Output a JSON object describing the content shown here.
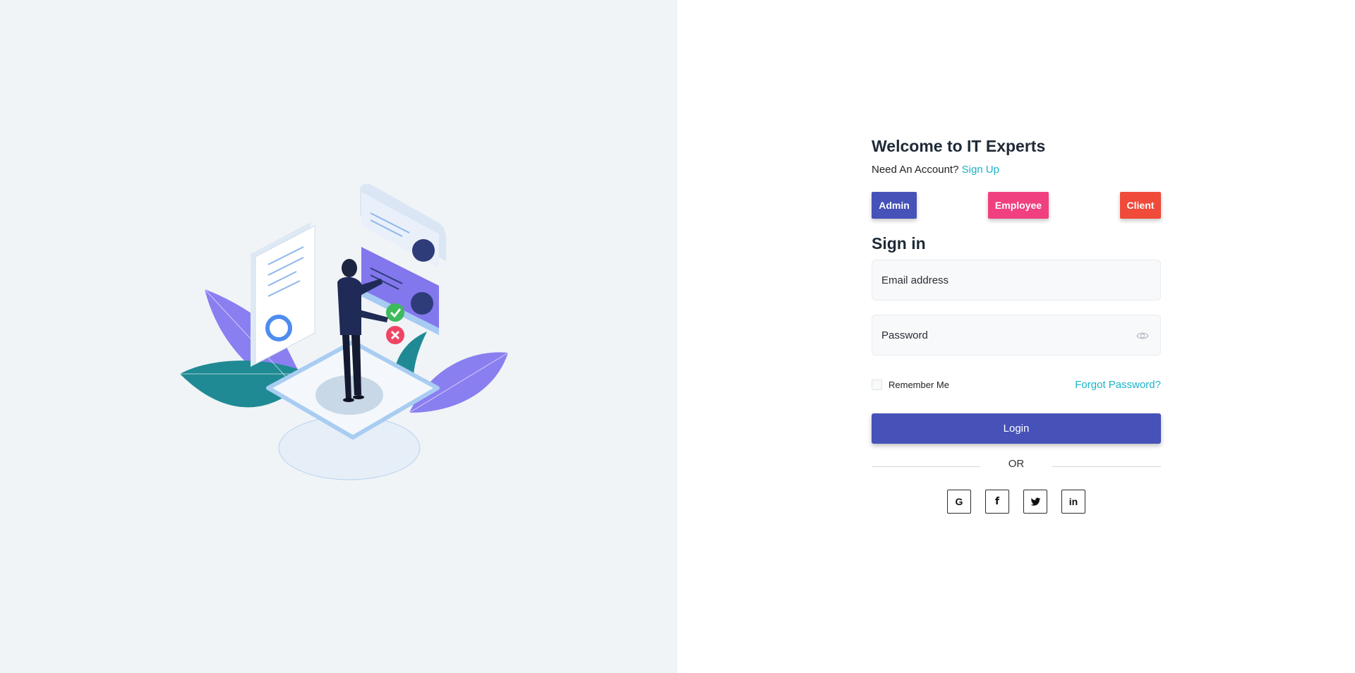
{
  "brand": {
    "welcome_title": "Welcome to IT Experts",
    "need_account_text": "Need An Account?",
    "sign_up_link": "Sign Up"
  },
  "roles": {
    "admin": "Admin",
    "employee": "Employee",
    "client": "Client"
  },
  "form": {
    "title": "Sign in",
    "email_placeholder": "Email address",
    "email_value": "",
    "password_placeholder": "Password",
    "password_value": "",
    "remember_label": "Remember Me",
    "forgot_link": "Forgot Password?",
    "login_label": "Login",
    "or_text": "OR"
  },
  "social": [
    {
      "icon": "google-icon",
      "glyph": "G"
    },
    {
      "icon": "facebook-icon",
      "glyph": "f"
    },
    {
      "icon": "twitter-icon",
      "glyph": ""
    },
    {
      "icon": "linkedin-icon",
      "glyph": "in"
    }
  ],
  "colors": {
    "primary": "#4652b8",
    "employee": "#f0407f",
    "client": "#ef4a3a",
    "link": "#1bb3c8",
    "left_bg": "#f0f4f7"
  }
}
